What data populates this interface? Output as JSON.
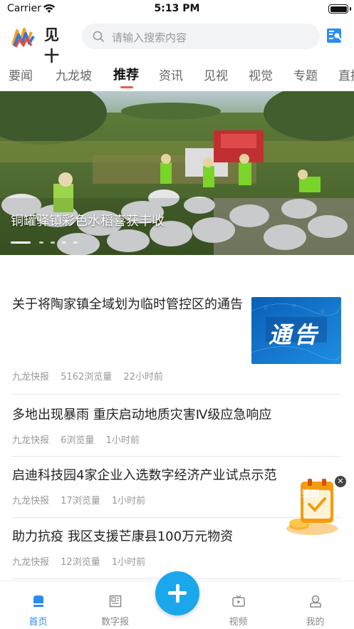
{
  "status_bar": {
    "carrier": "Carrier",
    "time": "5:13 PM"
  },
  "header": {
    "logo_text": "见十",
    "search_placeholder": "请输入搜索内容"
  },
  "tabs": [
    {
      "label": "要闻"
    },
    {
      "label": "九龙坡"
    },
    {
      "label": "推荐"
    },
    {
      "label": "资讯"
    },
    {
      "label": "见视"
    },
    {
      "label": "视觉"
    },
    {
      "label": "专题"
    },
    {
      "label": "直播"
    }
  ],
  "active_tab": "推荐",
  "banner": {
    "title": "铜罐驿镇彩色水稻喜获丰收",
    "slide_count": 5,
    "active_slide": 1
  },
  "news": [
    {
      "title": "关于将陶家镇全域划为临时管控区的通告",
      "source": "九龙快报",
      "views": "5162浏览量",
      "time": "22小时前",
      "thumb_text": "通告"
    },
    {
      "title": "多地出现暴雨 重庆启动地质灾害Ⅳ级应急响应",
      "source": "九龙快报",
      "views": "6浏览量",
      "time": "1小时前"
    },
    {
      "title": "启迪科技园4家企业入选数字经济产业试点示范",
      "source": "九龙快报",
      "views": "17浏览量",
      "time": "1小时前"
    },
    {
      "title": "助力抗疫 我区支援芒康县100万元物资",
      "source": "九龙快报",
      "views": "12浏览量",
      "time": "1小时前"
    }
  ],
  "signin_badge": "签到",
  "bottom_nav": [
    {
      "label": "首页"
    },
    {
      "label": "数字报"
    },
    {
      "label": "视频"
    },
    {
      "label": "我的"
    }
  ],
  "colors": {
    "accent": "#2d8cf0",
    "tab_indicator": "#e8604c",
    "center_button": "#1aa7ec"
  }
}
